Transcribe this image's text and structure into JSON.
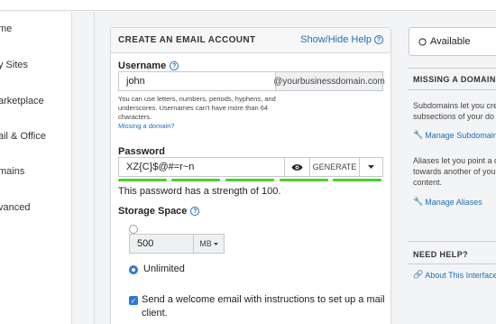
{
  "sidebar": {
    "items": [
      {
        "label": "me"
      },
      {
        "label": "y Sites"
      },
      {
        "label": "arketplace"
      },
      {
        "label": "ail & Office"
      },
      {
        "label": "mains"
      },
      {
        "label": "vanced"
      }
    ]
  },
  "card": {
    "title": "CREATE AN EMAIL ACCOUNT",
    "toggle_help": "Show/Hide Help"
  },
  "username": {
    "label": "Username",
    "value": "john",
    "domain": "@yourbusinessdomain.com",
    "help_line1": "You can use letters, numbers, periods, hyphens, and",
    "help_line2": "underscores. Usernames can't have more than 64",
    "help_line3": "characters.",
    "missing_domain": "Missing a domain?"
  },
  "password": {
    "label": "Password",
    "value": "XZ{C}$@#=r~n",
    "generate_label": "GENERATE",
    "strength_text": "This password has a strength of 100.",
    "strength_percent": 100
  },
  "storage": {
    "label": "Storage Space",
    "value": "500",
    "unit": "MB",
    "unlimited_label": "Unlimited",
    "selected": "Unlimited"
  },
  "welcome": {
    "checked": true,
    "line1": "Send a welcome email with instructions to set up a mail",
    "line2": "client."
  },
  "right": {
    "status": "Available",
    "missing_head": "MISSING A DOMAIN",
    "sub_line1": "Subdomains let you cre",
    "sub_line2": "subsections of your do",
    "manage_sub": "Manage Subdomains",
    "alias_line1": "Aliases let you point a d",
    "alias_line2": "towards another of you",
    "alias_line3": "content.",
    "manage_alias": "Manage Aliases",
    "need_help_head": "NEED HELP?",
    "about_link": "About This Interface"
  }
}
